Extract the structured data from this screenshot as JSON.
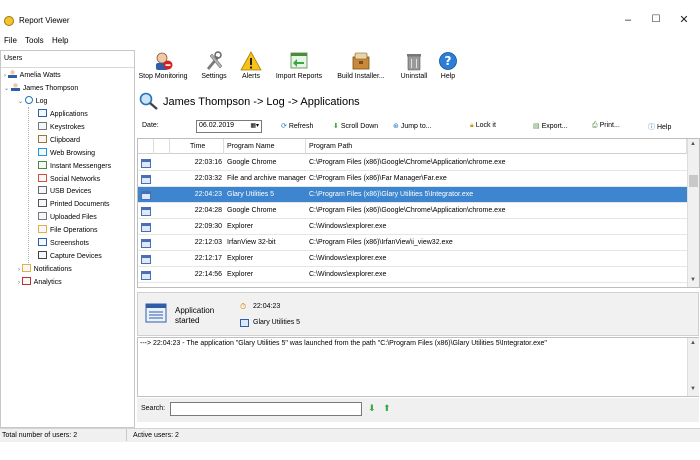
{
  "window": {
    "title": "Report Viewer",
    "minimize": "–",
    "maximize": "☐",
    "close": "✕"
  },
  "menu": [
    "File",
    "Tools",
    "Help"
  ],
  "users_panel": {
    "header": "Users",
    "tree": [
      {
        "label": "Amelia Watts",
        "level": 0,
        "toggle": ">",
        "icon": "user-icon"
      },
      {
        "label": "James Thompson",
        "level": 0,
        "toggle": "v",
        "icon": "user-icon"
      },
      {
        "label": "Log",
        "level": 1,
        "toggle": "v",
        "icon": "search-icon"
      },
      {
        "label": "Applications",
        "level": 2,
        "icon": "applications-icon"
      },
      {
        "label": "Keystrokes",
        "level": 2,
        "icon": "keyboard-icon"
      },
      {
        "label": "Clipboard",
        "level": 2,
        "icon": "clipboard-icon"
      },
      {
        "label": "Web Browsing",
        "level": 2,
        "icon": "globe-icon"
      },
      {
        "label": "Instant Messengers",
        "level": 2,
        "icon": "chat-icon"
      },
      {
        "label": "Social Networks",
        "level": 2,
        "icon": "social-icon"
      },
      {
        "label": "USB Devices",
        "level": 2,
        "icon": "usb-icon"
      },
      {
        "label": "Printed Documents",
        "level": 2,
        "icon": "printer-icon"
      },
      {
        "label": "Uploaded Files",
        "level": 2,
        "icon": "upload-icon"
      },
      {
        "label": "File Operations",
        "level": 2,
        "icon": "folder-icon"
      },
      {
        "label": "Screenshots",
        "level": 2,
        "icon": "monitor-icon"
      },
      {
        "label": "Capture Devices",
        "level": 2,
        "icon": "camera-icon"
      },
      {
        "label": "Notifications",
        "level": 1,
        "toggle": ">",
        "icon": "bell-icon"
      },
      {
        "label": "Analytics",
        "level": 1,
        "toggle": ">",
        "icon": "chart-icon"
      }
    ]
  },
  "toolbar": [
    {
      "label": "Stop Monitoring",
      "icon": "stop-monitoring-icon"
    },
    {
      "label": "Settings",
      "icon": "tools-icon"
    },
    {
      "label": "Alerts",
      "icon": "warning-icon"
    },
    {
      "label": "Import Reports",
      "icon": "import-icon"
    },
    {
      "label": "Build Installer...",
      "icon": "installer-icon"
    },
    {
      "label": "Uninstall",
      "icon": "trash-icon"
    },
    {
      "label": "Help",
      "icon": "help-icon"
    }
  ],
  "path_title": "James Thompson -> Log -> Applications",
  "filter": {
    "date_label": "Date:",
    "date_value": "06.02.2019",
    "refresh": "Refresh",
    "scroll_down": "Scroll Down",
    "jump_to": "Jump to...",
    "lock_it": "Lock it",
    "export": "Export...",
    "print": "Print...",
    "help": "Help"
  },
  "table": {
    "columns": [
      "Time",
      "Program Name",
      "Program Path"
    ],
    "rows": [
      {
        "time": "22:03:16",
        "name": "Google Chrome",
        "path": "C:\\Program Files (x86)\\Google\\Chrome\\Application\\chrome.exe"
      },
      {
        "time": "22:03:32",
        "name": "File and archive manager",
        "path": "C:\\Program Files (x86)\\Far Manager\\Far.exe"
      },
      {
        "time": "22:04:23",
        "name": "Glary Utilities 5",
        "path": "C:\\Program Files (x86)\\Glary Utilities 5\\Integrator.exe",
        "selected": true
      },
      {
        "time": "22:04:28",
        "name": "Google Chrome",
        "path": "C:\\Program Files (x86)\\Google\\Chrome\\Application\\chrome.exe"
      },
      {
        "time": "22:09:30",
        "name": "Explorer",
        "path": "C:\\Windows\\explorer.exe"
      },
      {
        "time": "22:12:03",
        "name": "IrfanView 32-bit",
        "path": "C:\\Program Files (x86)\\IrfanView\\i_view32.exe"
      },
      {
        "time": "22:12:17",
        "name": "Explorer",
        "path": "C:\\Windows\\explorer.exe"
      },
      {
        "time": "22:14:56",
        "name": "Explorer",
        "path": "C:\\Windows\\explorer.exe"
      }
    ]
  },
  "details": {
    "event_line1": "Application",
    "event_line2": "started",
    "time": "22:04:23",
    "program": "Glary Utilities 5"
  },
  "message": "---> 22:04:23 - The application \"Glary Utilities 5\" was launched from the path \"C:\\Program Files (x86)\\Glary Utilities 5\\Integrator.exe\"",
  "search": {
    "label": "Search:",
    "value": ""
  },
  "status": {
    "total_users": "Total number of users: 2",
    "active_users": "Active users: 2"
  },
  "colors": {
    "selection": "#3d86cf",
    "accent": "#1e73be"
  }
}
